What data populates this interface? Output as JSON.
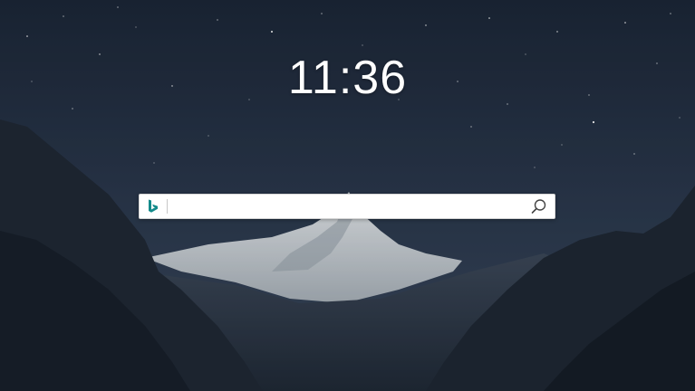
{
  "clock": {
    "time": "11:36"
  },
  "search": {
    "value": "",
    "placeholder": "",
    "engine_icon": "bing-logo-icon",
    "submit_icon": "search-icon"
  },
  "background": {
    "description_icon": "wallpaper",
    "colors": {
      "sky_top": "#1b2535",
      "sky_bottom": "#2f3d52",
      "mountain_dark": "#1c2530",
      "snow": "#dfe3e6",
      "bing_teal": "#138a8a"
    }
  }
}
